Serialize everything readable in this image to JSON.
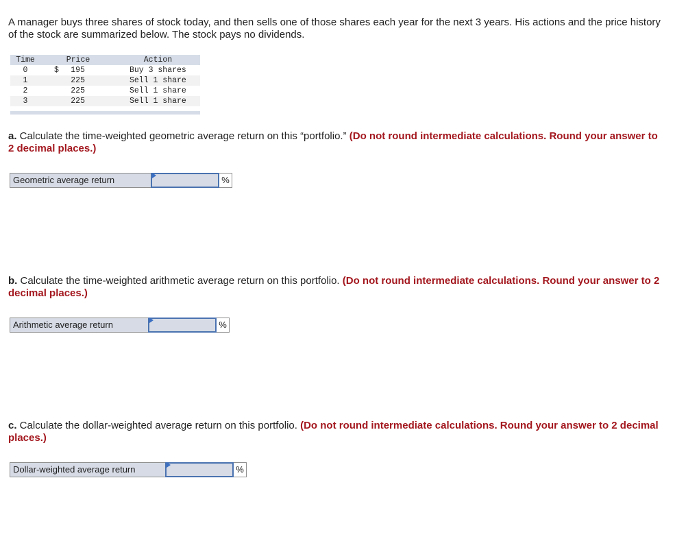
{
  "intro": "A manager buys three shares of stock today, and then sells one of those shares each year for the next 3 years. His actions and the price history of the stock are summarized below. The stock pays no dividends.",
  "table": {
    "headers": [
      "Time",
      "Price",
      "Action"
    ],
    "rows": [
      {
        "time": "0",
        "currency": "$",
        "price": "195",
        "action": "Buy 3 shares"
      },
      {
        "time": "1",
        "currency": "",
        "price": "225",
        "action": "Sell 1 share"
      },
      {
        "time": "2",
        "currency": "",
        "price": "225",
        "action": "Sell 1 share"
      },
      {
        "time": "3",
        "currency": "",
        "price": "225",
        "action": "Sell 1 share"
      }
    ]
  },
  "questions": [
    {
      "letter": "a.",
      "text": " Calculate the time-weighted geometric average return on this “portfolio.” ",
      "note": "(Do not round intermediate calculations. Round your answer to 2 decimal places.)",
      "answer_label": "Geometric average return",
      "answer_value": "",
      "unit": "%"
    },
    {
      "letter": "b.",
      "text": " Calculate the time-weighted arithmetic average return on this portfolio. ",
      "note": "(Do not round intermediate calculations. Round your answer to 2 decimal places.)",
      "answer_label": "Arithmetic average return",
      "answer_value": "",
      "unit": "%"
    },
    {
      "letter": "c.",
      "text": " Calculate the dollar-weighted average return on this portfolio. ",
      "note": "(Do not round intermediate calculations. Round your answer to 2 decimal places.)",
      "answer_label": "Dollar-weighted average return",
      "answer_value": "",
      "unit": "%"
    }
  ],
  "colors": {
    "note_red": "#a3171e",
    "table_header_bg": "#d6dde8",
    "input_border_blue": "#4a72b0"
  }
}
